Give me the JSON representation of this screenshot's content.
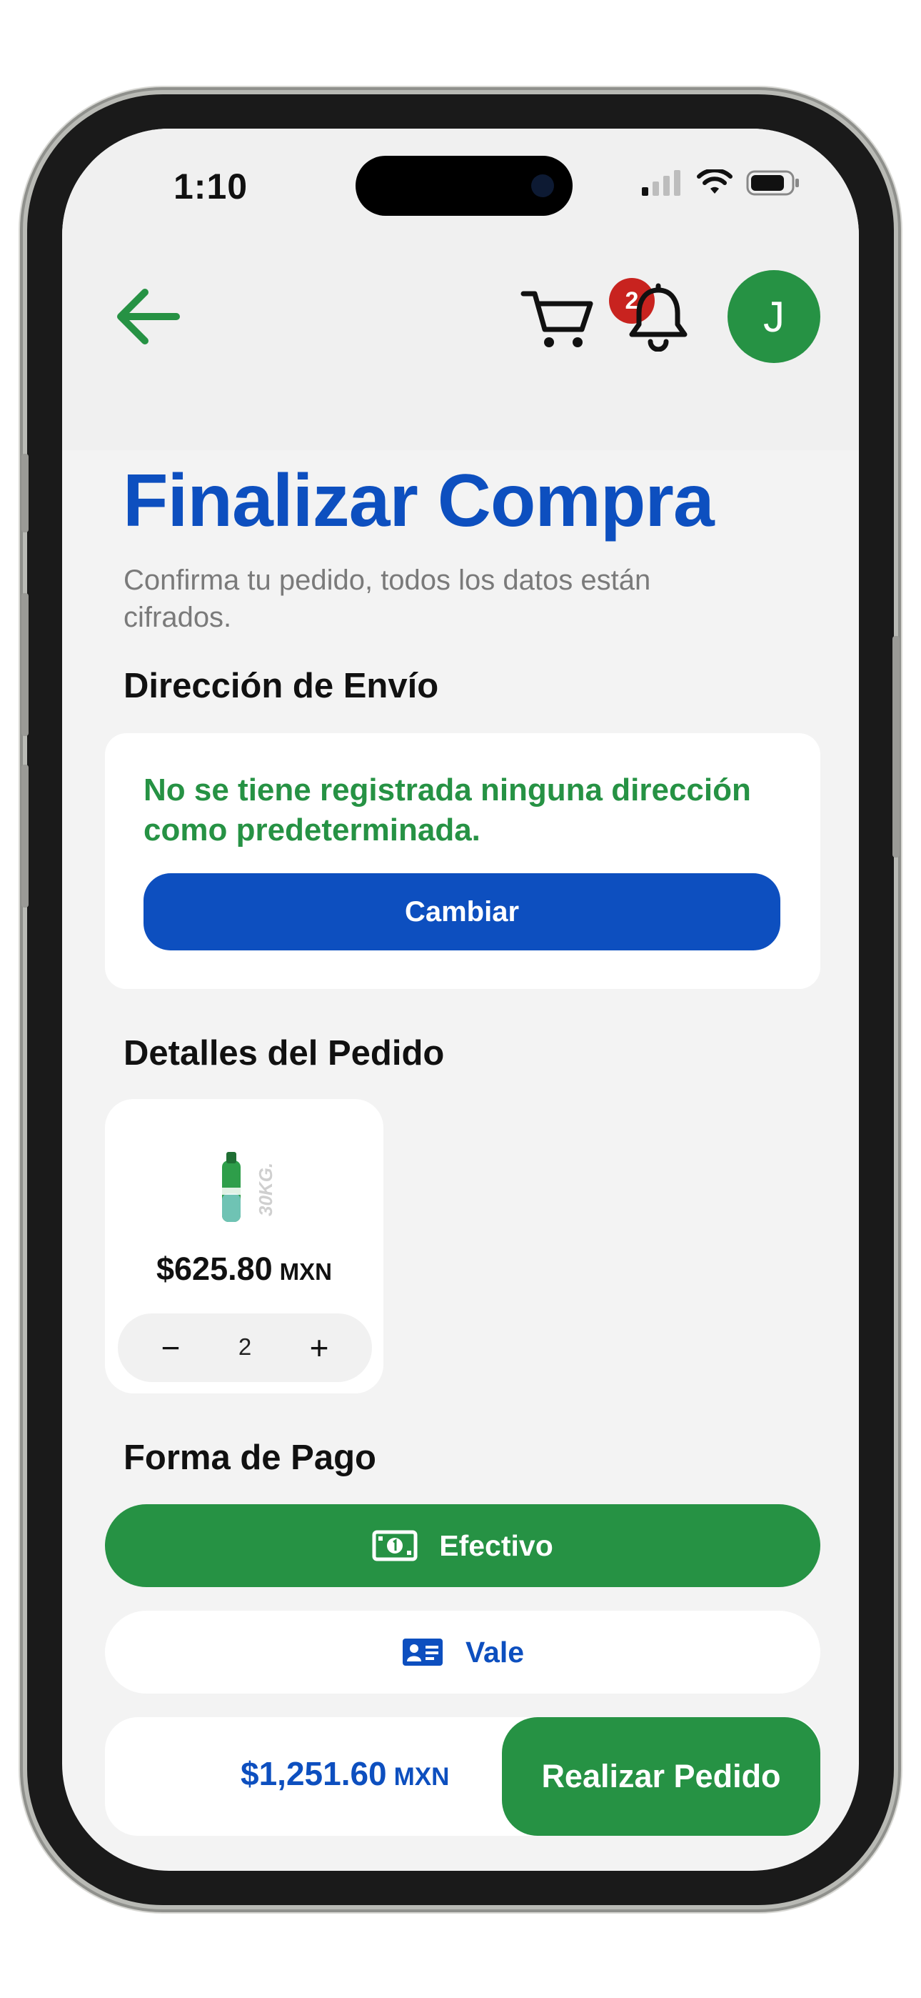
{
  "status_bar": {
    "time": "1:10"
  },
  "header": {
    "cart_count": "2",
    "avatar_initial": "J",
    "icons": {
      "back": "arrow-left-icon",
      "cart": "cart-icon",
      "bell": "bell-icon"
    }
  },
  "page": {
    "title": "Finalizar Compra",
    "subtitle": "Confirma tu pedido, todos los datos están cifrados."
  },
  "shipping": {
    "section_title": "Dirección de Envío",
    "message": "No se tiene registrada ninguna dirección como predeterminada.",
    "change_button": "Cambiar"
  },
  "order": {
    "section_title": "Detalles del Pedido",
    "items": [
      {
        "image_icon": "gas-cylinder-image",
        "image_label": "30KG.",
        "price": "$625.80",
        "currency": "MXN",
        "quantity": "2",
        "minus": "−",
        "plus": "+"
      }
    ]
  },
  "payment": {
    "section_title": "Forma de Pago",
    "methods": [
      {
        "label": "Efectivo",
        "icon": "cash-icon",
        "selected": true
      },
      {
        "label": "Vale",
        "icon": "id-card-icon",
        "selected": false
      }
    ]
  },
  "footer": {
    "total": "$1,251.60",
    "currency": "MXN",
    "submit_button": "Realizar Pedido"
  },
  "colors": {
    "primary_blue": "#0d4fbf",
    "brand_green": "#269244",
    "badge_red": "#c8231f",
    "background": "#f3f3f3"
  }
}
